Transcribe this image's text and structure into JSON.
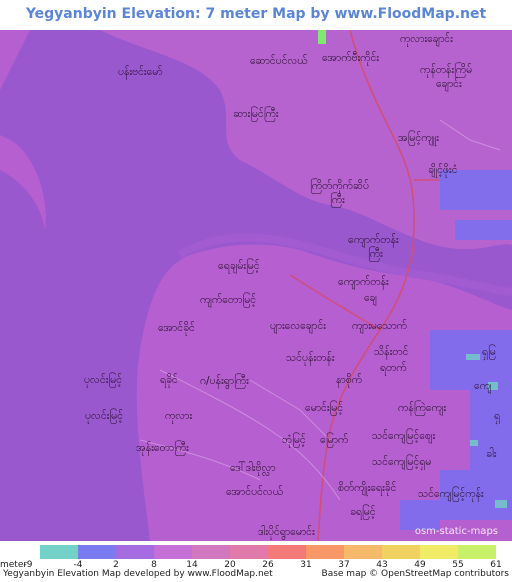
{
  "title": "Yegyanbyin Elevation: 7 meter Map by www.FloodMap.net (beta)",
  "map": {
    "credit": "osm-static-maps",
    "labels": [
      {
        "text": "ကုလားချောင်း"
      },
      {
        "text": "ပန်းဗင်းမော်"
      },
      {
        "text": "ဆောင်ပင်လယ်"
      },
      {
        "text": "အောက်ဗီးကိုင်း"
      },
      {
        "text": "ကုန်တန်းကြိမ်"
      },
      {
        "text": "ချောင်း"
      },
      {
        "text": "ဆားမြင်ကြီး"
      },
      {
        "text": "အမြင့်ကျူး"
      },
      {
        "text": "ချိုင့်ဖိုးငံ"
      },
      {
        "text": "ကြိတ်ကိုက်ဆိပ်"
      },
      {
        "text": "ကြီး"
      },
      {
        "text": "ကျောက်တန်း"
      },
      {
        "text": "ကြီး"
      },
      {
        "text": "ရေချမ်းမြင့်"
      },
      {
        "text": "ကျောက်တန်း"
      },
      {
        "text": "ချေ"
      },
      {
        "text": "ကျက်တောမြင့်"
      },
      {
        "text": "အောင်ခိုင်"
      },
      {
        "text": "ပျားလေချောင်း"
      },
      {
        "text": "ကျားမသောက်"
      },
      {
        "text": "သင်ပုန်းတန်း"
      },
      {
        "text": "သိန်းတင်"
      },
      {
        "text": "ရတက်"
      },
      {
        "text": "ပုလင်းမြင့်"
      },
      {
        "text": "ရခိုင်"
      },
      {
        "text": "ဂ/ပန်းရွာကြီး"
      },
      {
        "text": "နာစိုက်"
      },
      {
        "text": "မောင်းမြင့်"
      },
      {
        "text": "ကန်ကြဲကျေး"
      },
      {
        "text": "ပုလင်းမြင့်"
      },
      {
        "text": "ကုလား"
      },
      {
        "text": "ဘုံမြင့်"
      },
      {
        "text": "မြောက်"
      },
      {
        "text": "သင်ကျေမြင့်စျေး"
      },
      {
        "text": "အုန်းတောကြီး"
      },
      {
        "text": "ဒေါ်ဒါးဗိုလ္လာ"
      },
      {
        "text": "သင်ကျေမြင့်ရှမ"
      },
      {
        "text": "အောင်ပင်လယ်"
      },
      {
        "text": "စိတ်ကျိုးရေးခိုင်"
      },
      {
        "text": "သင်ကျေမြင့်ကုန်း"
      },
      {
        "text": "ခရမြင့်"
      },
      {
        "text": "ဒါးပိုင်ရွာမောင်း"
      },
      {
        "text": "ကျေ"
      },
      {
        "text": "ရှ"
      },
      {
        "text": "ခါး"
      },
      {
        "text": "ရှမြ"
      }
    ]
  },
  "legend": {
    "unit_label": "meter",
    "steps": [
      {
        "value": "-9",
        "color": "#74d1c8"
      },
      {
        "value": "-4",
        "color": "#7b7bf0"
      },
      {
        "value": "2",
        "color": "#a46ce0"
      },
      {
        "value": "8",
        "color": "#c56fd6"
      },
      {
        "value": "14",
        "color": "#d077c0"
      },
      {
        "value": "20",
        "color": "#e07aaa"
      },
      {
        "value": "26",
        "color": "#f47a7a"
      },
      {
        "value": "31",
        "color": "#f89868"
      },
      {
        "value": "37",
        "color": "#f6b86a"
      },
      {
        "value": "43",
        "color": "#f0d260"
      },
      {
        "value": "49",
        "color": "#f0ec68"
      },
      {
        "value": "55",
        "color": "#c8f068"
      },
      {
        "value": "61",
        "color": "#7ee870"
      }
    ]
  },
  "footer": {
    "left": "Yegyanbyin Elevation Map developed by www.FloodMap.net",
    "right": "Base map © OpenStreetMap contributors"
  },
  "colors": {
    "water": "#9a58cf",
    "land": "#b65fd0",
    "low_land": "#7a6ff0",
    "road": "#d04f7a",
    "title": "#5b86d8"
  }
}
